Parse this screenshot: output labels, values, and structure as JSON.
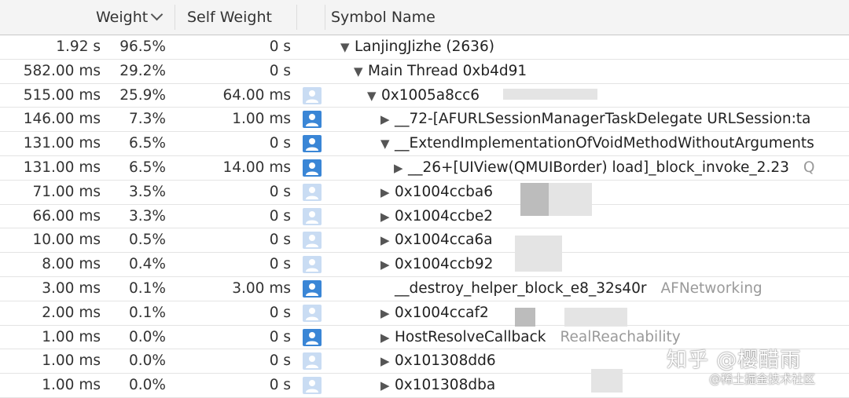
{
  "header": {
    "weight_label": "Weight",
    "self_weight_label": "Self Weight",
    "symbol_label": "Symbol Name"
  },
  "rows": [
    {
      "weight": "1.92 s",
      "percent": "96.5%",
      "self": "0 s",
      "icon": "none",
      "indent": 0,
      "disclosure": "expanded",
      "symbol": "LanjingJizhe (2636)",
      "library": ""
    },
    {
      "weight": "582.00 ms",
      "percent": "29.2%",
      "self": "0 s",
      "icon": "none",
      "indent": 1,
      "disclosure": "expanded",
      "symbol": "Main Thread  0xb4d91",
      "library": ""
    },
    {
      "weight": "515.00 ms",
      "percent": "25.9%",
      "self": "64.00 ms",
      "icon": "light",
      "indent": 2,
      "disclosure": "expanded",
      "symbol": "0x1005a8cc6",
      "library": ""
    },
    {
      "weight": "146.00 ms",
      "percent": "7.3%",
      "self": "1.00 ms",
      "icon": "dark",
      "indent": 3,
      "disclosure": "collapsed",
      "symbol": "__72-[AFURLSessionManagerTaskDelegate URLSession:ta",
      "library": ""
    },
    {
      "weight": "131.00 ms",
      "percent": "6.5%",
      "self": "0 s",
      "icon": "dark",
      "indent": 3,
      "disclosure": "expanded",
      "symbol": "__ExtendImplementationOfVoidMethodWithoutArguments",
      "library": ""
    },
    {
      "weight": "131.00 ms",
      "percent": "6.5%",
      "self": "14.00 ms",
      "icon": "dark",
      "indent": 4,
      "disclosure": "collapsed",
      "symbol": "__26+[UIView(QMUIBorder) load]_block_invoke_2.23",
      "library": "Q"
    },
    {
      "weight": "71.00 ms",
      "percent": "3.5%",
      "self": "0 s",
      "icon": "light",
      "indent": 3,
      "disclosure": "collapsed",
      "symbol": "0x1004ccba6",
      "library": ""
    },
    {
      "weight": "66.00 ms",
      "percent": "3.3%",
      "self": "0 s",
      "icon": "light",
      "indent": 3,
      "disclosure": "collapsed",
      "symbol": "0x1004ccbe2",
      "library": ""
    },
    {
      "weight": "10.00 ms",
      "percent": "0.5%",
      "self": "0 s",
      "icon": "light",
      "indent": 3,
      "disclosure": "collapsed",
      "symbol": "0x1004cca6a",
      "library": ""
    },
    {
      "weight": "8.00 ms",
      "percent": "0.4%",
      "self": "0 s",
      "icon": "light",
      "indent": 3,
      "disclosure": "collapsed",
      "symbol": "0x1004ccb92",
      "library": ""
    },
    {
      "weight": "3.00 ms",
      "percent": "0.1%",
      "self": "3.00 ms",
      "icon": "dark",
      "indent": 3,
      "disclosure": "none",
      "symbol": "__destroy_helper_block_e8_32s40r",
      "library": "AFNetworking"
    },
    {
      "weight": "2.00 ms",
      "percent": "0.1%",
      "self": "0 s",
      "icon": "light",
      "indent": 3,
      "disclosure": "collapsed",
      "symbol": "0x1004ccaf2",
      "library": ""
    },
    {
      "weight": "1.00 ms",
      "percent": "0.0%",
      "self": "0 s",
      "icon": "dark",
      "indent": 3,
      "disclosure": "collapsed",
      "symbol": "HostResolveCallback",
      "library": "RealReachability"
    },
    {
      "weight": "1.00 ms",
      "percent": "0.0%",
      "self": "0 s",
      "icon": "light",
      "indent": 3,
      "disclosure": "collapsed",
      "symbol": "0x101308dd6",
      "library": ""
    },
    {
      "weight": "1.00 ms",
      "percent": "0.0%",
      "self": "0 s",
      "icon": "light",
      "indent": 3,
      "disclosure": "collapsed",
      "symbol": "0x101308dba",
      "library": ""
    }
  ],
  "watermark": {
    "line1": "知乎 @樱醋雨",
    "line2": "@稀土掘金技术社区"
  }
}
